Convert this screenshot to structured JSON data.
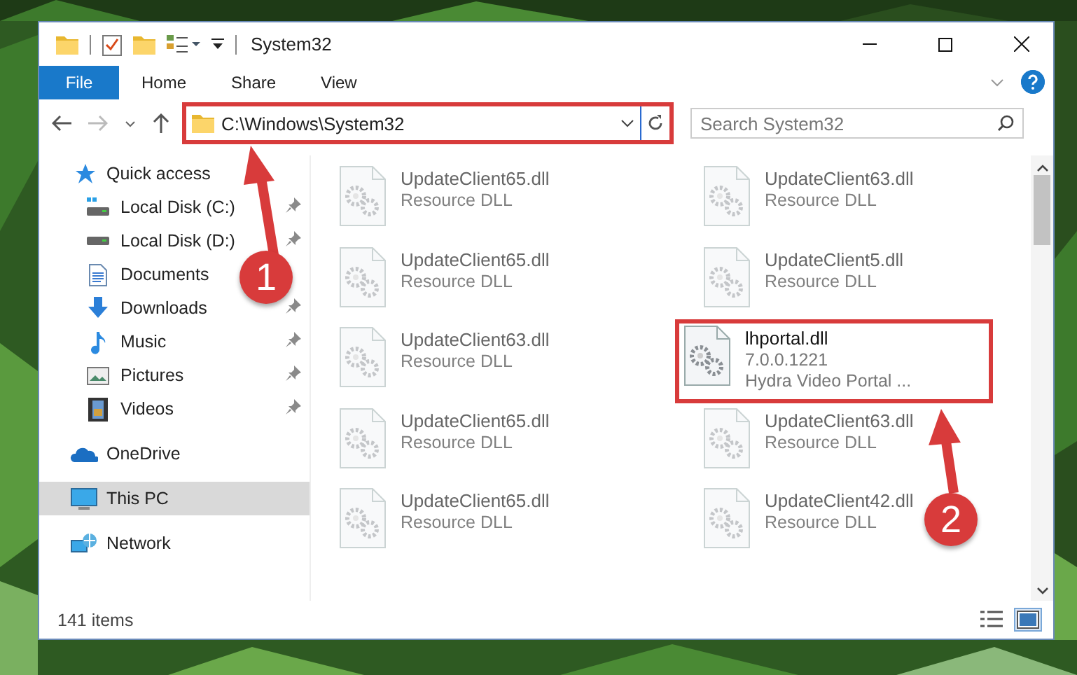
{
  "window": {
    "title": "System32"
  },
  "ribbon": {
    "tabs": [
      {
        "label": "File",
        "kind": "file",
        "selected": false
      },
      {
        "label": "Home",
        "kind": "tab",
        "selected": false
      },
      {
        "label": "Share",
        "kind": "tab",
        "selected": false
      },
      {
        "label": "View",
        "kind": "tab",
        "selected": false
      }
    ]
  },
  "address": {
    "path": "C:\\Windows\\System32",
    "highlighted": true
  },
  "search": {
    "placeholder": "Search System32"
  },
  "nav": [
    {
      "label": "Quick access",
      "kind": "star",
      "selected": false,
      "children": [
        {
          "label": "Local Disk (C:)",
          "kind": "drive-c",
          "pinned": true,
          "selected": false
        },
        {
          "label": "Local Disk (D:)",
          "kind": "drive",
          "pinned": true,
          "selected": false
        },
        {
          "label": "Documents",
          "kind": "documents",
          "pinned": false,
          "selected": false
        },
        {
          "label": "Downloads",
          "kind": "downloads",
          "pinned": true,
          "selected": false
        },
        {
          "label": "Music",
          "kind": "music",
          "pinned": true,
          "selected": false
        },
        {
          "label": "Pictures",
          "kind": "pictures",
          "pinned": true,
          "selected": false
        },
        {
          "label": "Videos",
          "kind": "videos",
          "pinned": true,
          "selected": false
        }
      ]
    },
    {
      "label": "OneDrive",
      "kind": "cloud",
      "selected": false
    },
    {
      "label": "This PC",
      "kind": "pc",
      "selected": true
    },
    {
      "label": "Network",
      "kind": "network",
      "selected": false
    }
  ],
  "files": [
    {
      "name": "UpdateClient65.dll",
      "lines": [
        "Resource DLL"
      ],
      "blurred": true,
      "highlighted": false
    },
    {
      "name": "UpdateClient63.dll",
      "lines": [
        "Resource DLL"
      ],
      "blurred": true,
      "highlighted": false
    },
    {
      "name": "UpdateClient65.dll",
      "lines": [
        "Resource DLL"
      ],
      "blurred": true,
      "highlighted": false
    },
    {
      "name": "UpdateClient5.dll",
      "lines": [
        "Resource DLL"
      ],
      "blurred": true,
      "highlighted": false
    },
    {
      "name": "UpdateClient63.dll",
      "lines": [
        "Resource DLL"
      ],
      "blurred": true,
      "highlighted": false
    },
    {
      "name": "lhportal.dll",
      "lines": [
        "7.0.0.1221",
        "Hydra Video Portal ..."
      ],
      "blurred": false,
      "highlighted": true
    },
    {
      "name": "UpdateClient65.dll",
      "lines": [
        "Resource DLL"
      ],
      "blurred": true,
      "highlighted": false
    },
    {
      "name": "UpdateClient63.dll",
      "lines": [
        "Resource DLL"
      ],
      "blurred": true,
      "highlighted": false
    },
    {
      "name": "UpdateClient65.dll",
      "lines": [
        "Resource DLL"
      ],
      "blurred": true,
      "highlighted": false
    },
    {
      "name": "UpdateClient42.dll",
      "lines": [
        "Resource DLL"
      ],
      "blurred": true,
      "highlighted": false
    }
  ],
  "status_bar": {
    "count": "141 items",
    "views": [
      {
        "kind": "details",
        "selected": false
      },
      {
        "kind": "tiles",
        "selected": true
      }
    ]
  },
  "annotations": [
    {
      "label": "1"
    },
    {
      "label": "2"
    }
  ]
}
